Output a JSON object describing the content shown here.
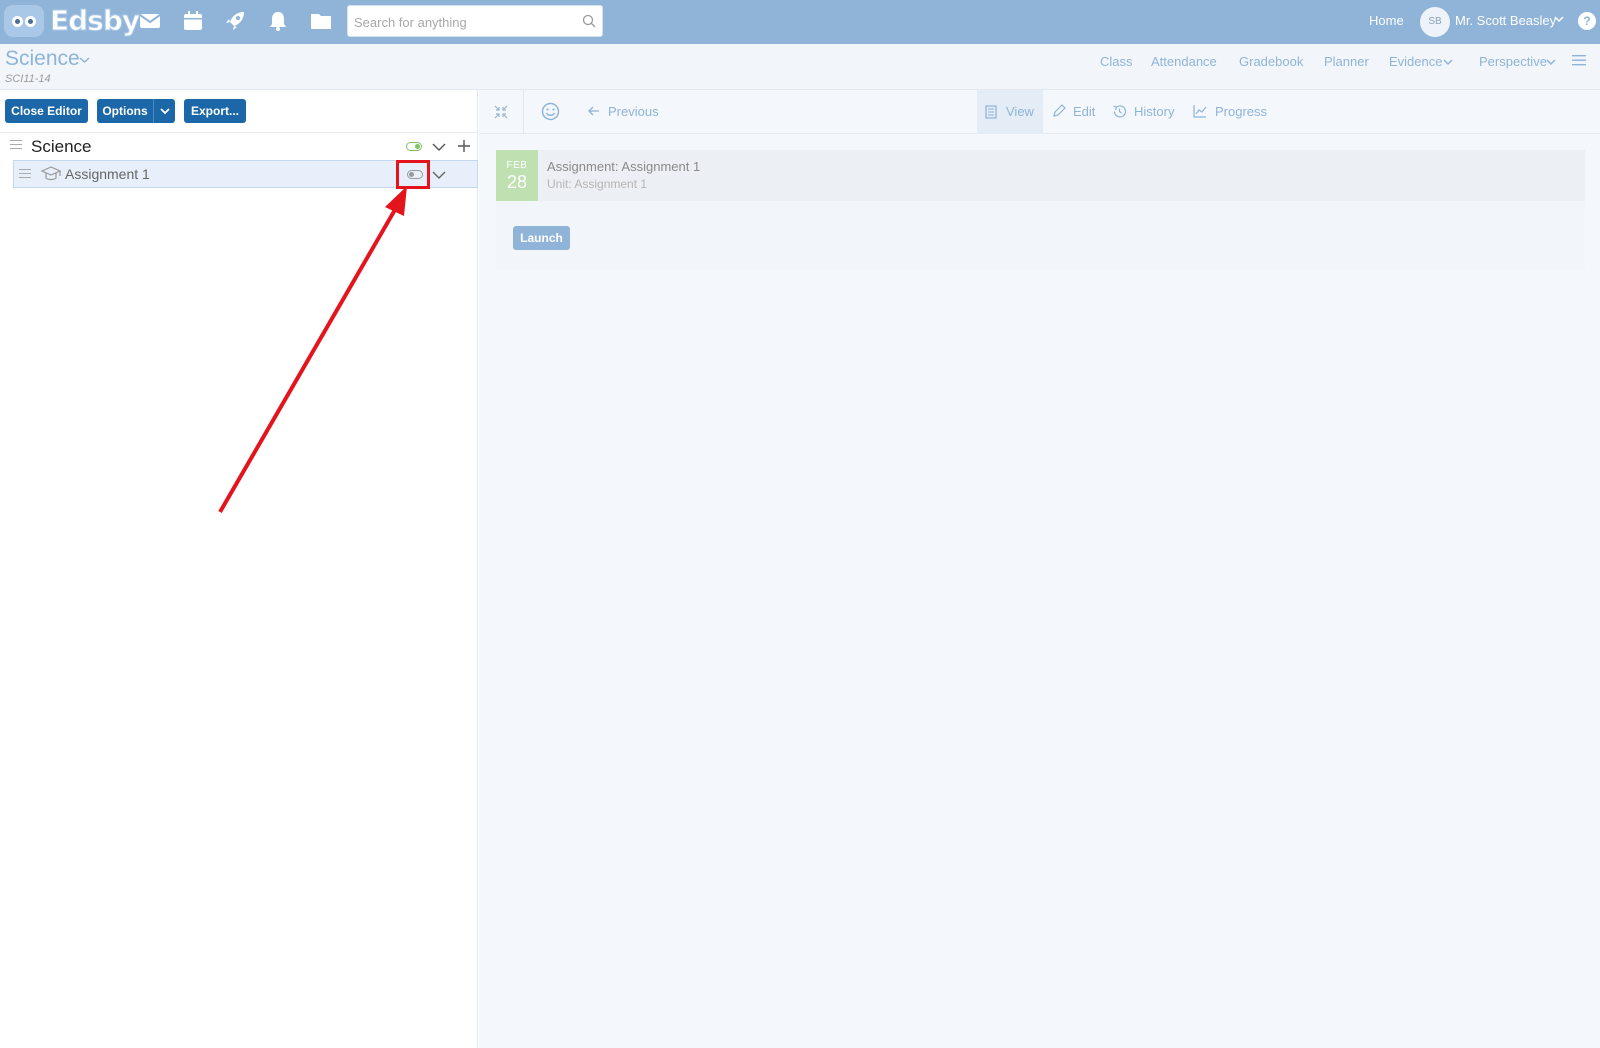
{
  "topbar": {
    "logo_text": "Edsby",
    "search_placeholder": "Search for anything",
    "home_label": "Home",
    "user": {
      "initials": "SB",
      "name": "Mr. Scott Beasley"
    },
    "help_label": "?"
  },
  "course": {
    "title": "Science",
    "code": "SCI11-14",
    "nav": [
      {
        "label": "Class"
      },
      {
        "label": "Attendance"
      },
      {
        "label": "Gradebook"
      },
      {
        "label": "Planner"
      },
      {
        "label": "Evidence"
      },
      {
        "label": "Perspective"
      }
    ]
  },
  "editor": {
    "close_label": "Close Editor",
    "options_label": "Options",
    "export_label": "Export..."
  },
  "tree": {
    "root_title": "Science",
    "root_toggle_on": true,
    "items": [
      {
        "title": "Assignment 1",
        "toggle_on": false
      }
    ]
  },
  "detail": {
    "previous_label": "Previous",
    "tabs": {
      "view": "View",
      "edit": "Edit",
      "history": "History",
      "progress": "Progress"
    },
    "card": {
      "month": "FEB",
      "day": "28",
      "title": "Assignment: Assignment 1",
      "subtitle": "Unit: Assignment 1",
      "launch_label": "Launch"
    }
  },
  "colors": {
    "topbar": "#8fb4d8",
    "primary_button": "#1b67a8",
    "annotation": "#e3141b",
    "date_block": "#bfe0b0"
  }
}
